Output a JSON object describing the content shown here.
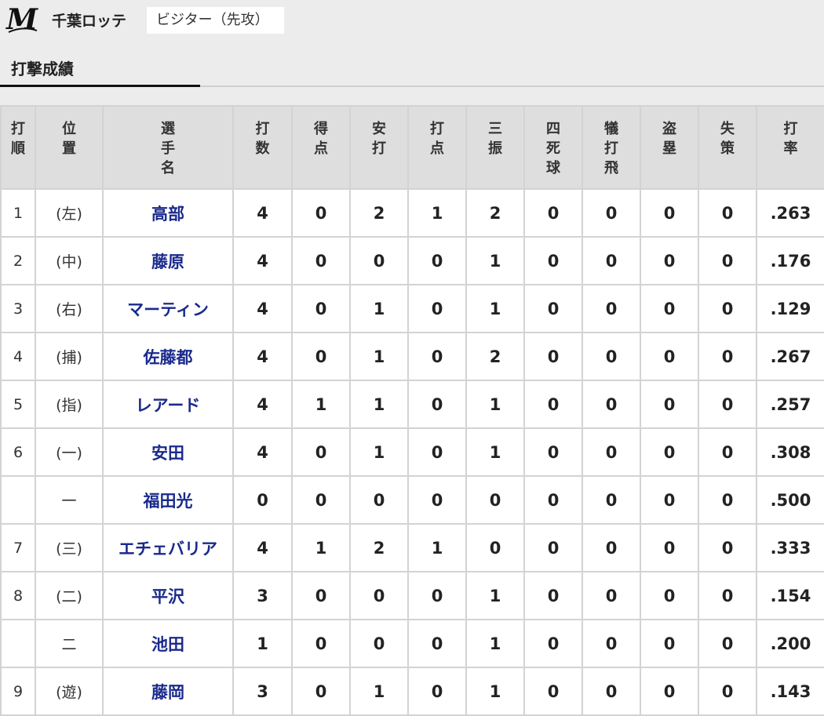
{
  "header": {
    "team_name": "千葉ロッテ",
    "side": "ビジター（先攻）",
    "logo_icon": "marines-m-logo",
    "logo_text": "M"
  },
  "section": {
    "title": "打撃成績"
  },
  "table": {
    "columns": [
      "打順",
      "位置",
      "選手名",
      "打数",
      "得点",
      "安打",
      "打点",
      "三振",
      "四死球",
      "犠打飛",
      "盗塁",
      "失策",
      "打率"
    ],
    "rows": [
      {
        "order": "1",
        "position": "(左)",
        "player": "高部",
        "ab": "4",
        "r": "0",
        "h": "2",
        "rbi": "1",
        "so": "2",
        "bb": "0",
        "sac": "0",
        "sb": "0",
        "e": "0",
        "avg": ".263"
      },
      {
        "order": "2",
        "position": "(中)",
        "player": "藤原",
        "ab": "4",
        "r": "0",
        "h": "0",
        "rbi": "0",
        "so": "1",
        "bb": "0",
        "sac": "0",
        "sb": "0",
        "e": "0",
        "avg": ".176"
      },
      {
        "order": "3",
        "position": "(右)",
        "player": "マーティン",
        "ab": "4",
        "r": "0",
        "h": "1",
        "rbi": "0",
        "so": "1",
        "bb": "0",
        "sac": "0",
        "sb": "0",
        "e": "0",
        "avg": ".129"
      },
      {
        "order": "4",
        "position": "(捕)",
        "player": "佐藤都",
        "ab": "4",
        "r": "0",
        "h": "1",
        "rbi": "0",
        "so": "2",
        "bb": "0",
        "sac": "0",
        "sb": "0",
        "e": "0",
        "avg": ".267"
      },
      {
        "order": "5",
        "position": "(指)",
        "player": "レアード",
        "ab": "4",
        "r": "1",
        "h": "1",
        "rbi": "0",
        "so": "1",
        "bb": "0",
        "sac": "0",
        "sb": "0",
        "e": "0",
        "avg": ".257"
      },
      {
        "order": "6",
        "position": "(一)",
        "player": "安田",
        "ab": "4",
        "r": "0",
        "h": "1",
        "rbi": "0",
        "so": "1",
        "bb": "0",
        "sac": "0",
        "sb": "0",
        "e": "0",
        "avg": ".308"
      },
      {
        "order": "",
        "position": "一",
        "player": "福田光",
        "ab": "0",
        "r": "0",
        "h": "0",
        "rbi": "0",
        "so": "0",
        "bb": "0",
        "sac": "0",
        "sb": "0",
        "e": "0",
        "avg": ".500"
      },
      {
        "order": "7",
        "position": "(三)",
        "player": "エチェバリア",
        "ab": "4",
        "r": "1",
        "h": "2",
        "rbi": "1",
        "so": "0",
        "bb": "0",
        "sac": "0",
        "sb": "0",
        "e": "0",
        "avg": ".333"
      },
      {
        "order": "8",
        "position": "(二)",
        "player": "平沢",
        "ab": "3",
        "r": "0",
        "h": "0",
        "rbi": "0",
        "so": "1",
        "bb": "0",
        "sac": "0",
        "sb": "0",
        "e": "0",
        "avg": ".154"
      },
      {
        "order": "",
        "position": "二",
        "player": "池田",
        "ab": "1",
        "r": "0",
        "h": "0",
        "rbi": "0",
        "so": "1",
        "bb": "0",
        "sac": "0",
        "sb": "0",
        "e": "0",
        "avg": ".200"
      },
      {
        "order": "9",
        "position": "(遊)",
        "player": "藤岡",
        "ab": "3",
        "r": "0",
        "h": "1",
        "rbi": "0",
        "so": "1",
        "bb": "0",
        "sac": "0",
        "sb": "0",
        "e": "0",
        "avg": ".143"
      }
    ]
  },
  "colors": {
    "player_link": "#1a2a8c",
    "header_bg": "#dedede",
    "page_bg": "#ececec"
  }
}
